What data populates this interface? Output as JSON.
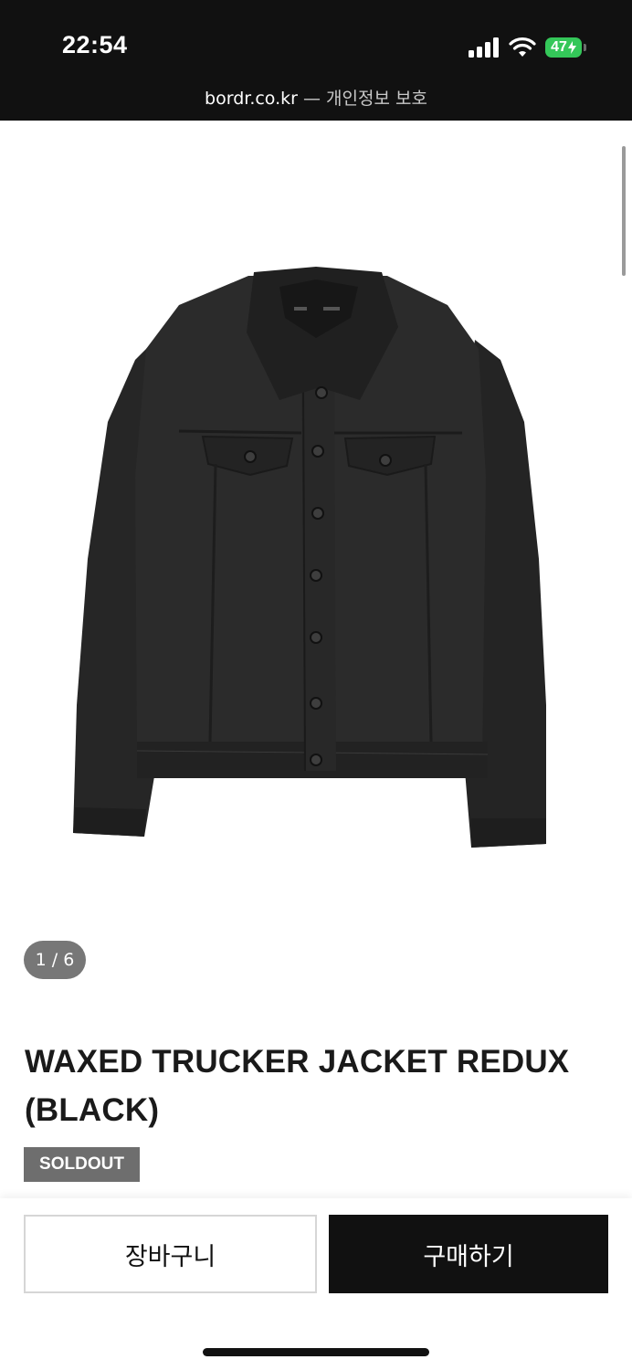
{
  "status_bar": {
    "time": "22:54",
    "battery_level": "47",
    "icons": [
      "signal-icon",
      "wifi-icon",
      "battery-charging-icon"
    ]
  },
  "browser": {
    "domain": "bordr.co.kr",
    "separator": " — ",
    "privacy_label": "개인정보 보호"
  },
  "product": {
    "image_icon": "black-trucker-jacket-image",
    "image_counter": "1 / 6",
    "title": "WAXED TRUCKER JACKET REDUX (BLACK)",
    "status_badge": "SOLDOUT"
  },
  "actions": {
    "cart_label": "장바구니",
    "buy_label": "구매하기"
  },
  "colors": {
    "header_bg": "#111111",
    "buy_button_bg": "#111111",
    "badge_bg": "#6e6e6e",
    "battery_green": "#34c759"
  }
}
